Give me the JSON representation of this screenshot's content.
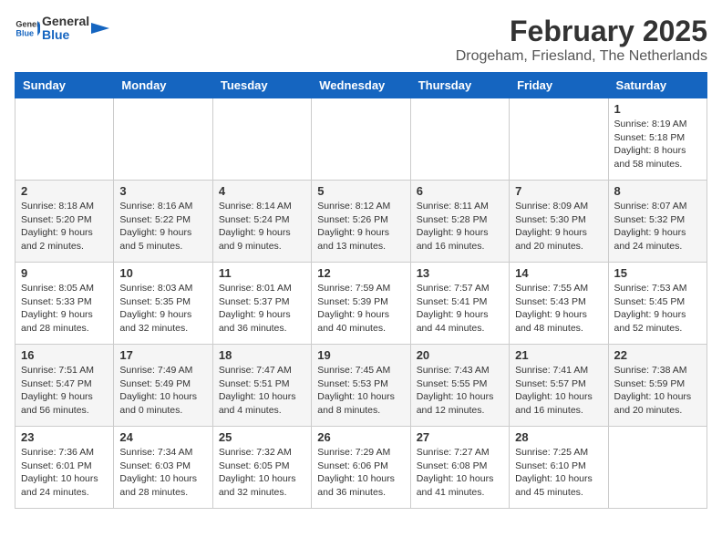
{
  "header": {
    "logo_general": "General",
    "logo_blue": "Blue",
    "month_year": "February 2025",
    "location": "Drogeham, Friesland, The Netherlands"
  },
  "weekdays": [
    "Sunday",
    "Monday",
    "Tuesday",
    "Wednesday",
    "Thursday",
    "Friday",
    "Saturday"
  ],
  "weeks": [
    [
      {
        "day": "",
        "info": ""
      },
      {
        "day": "",
        "info": ""
      },
      {
        "day": "",
        "info": ""
      },
      {
        "day": "",
        "info": ""
      },
      {
        "day": "",
        "info": ""
      },
      {
        "day": "",
        "info": ""
      },
      {
        "day": "1",
        "info": "Sunrise: 8:19 AM\nSunset: 5:18 PM\nDaylight: 8 hours and 58 minutes."
      }
    ],
    [
      {
        "day": "2",
        "info": "Sunrise: 8:18 AM\nSunset: 5:20 PM\nDaylight: 9 hours and 2 minutes."
      },
      {
        "day": "3",
        "info": "Sunrise: 8:16 AM\nSunset: 5:22 PM\nDaylight: 9 hours and 5 minutes."
      },
      {
        "day": "4",
        "info": "Sunrise: 8:14 AM\nSunset: 5:24 PM\nDaylight: 9 hours and 9 minutes."
      },
      {
        "day": "5",
        "info": "Sunrise: 8:12 AM\nSunset: 5:26 PM\nDaylight: 9 hours and 13 minutes."
      },
      {
        "day": "6",
        "info": "Sunrise: 8:11 AM\nSunset: 5:28 PM\nDaylight: 9 hours and 16 minutes."
      },
      {
        "day": "7",
        "info": "Sunrise: 8:09 AM\nSunset: 5:30 PM\nDaylight: 9 hours and 20 minutes."
      },
      {
        "day": "8",
        "info": "Sunrise: 8:07 AM\nSunset: 5:32 PM\nDaylight: 9 hours and 24 minutes."
      }
    ],
    [
      {
        "day": "9",
        "info": "Sunrise: 8:05 AM\nSunset: 5:33 PM\nDaylight: 9 hours and 28 minutes."
      },
      {
        "day": "10",
        "info": "Sunrise: 8:03 AM\nSunset: 5:35 PM\nDaylight: 9 hours and 32 minutes."
      },
      {
        "day": "11",
        "info": "Sunrise: 8:01 AM\nSunset: 5:37 PM\nDaylight: 9 hours and 36 minutes."
      },
      {
        "day": "12",
        "info": "Sunrise: 7:59 AM\nSunset: 5:39 PM\nDaylight: 9 hours and 40 minutes."
      },
      {
        "day": "13",
        "info": "Sunrise: 7:57 AM\nSunset: 5:41 PM\nDaylight: 9 hours and 44 minutes."
      },
      {
        "day": "14",
        "info": "Sunrise: 7:55 AM\nSunset: 5:43 PM\nDaylight: 9 hours and 48 minutes."
      },
      {
        "day": "15",
        "info": "Sunrise: 7:53 AM\nSunset: 5:45 PM\nDaylight: 9 hours and 52 minutes."
      }
    ],
    [
      {
        "day": "16",
        "info": "Sunrise: 7:51 AM\nSunset: 5:47 PM\nDaylight: 9 hours and 56 minutes."
      },
      {
        "day": "17",
        "info": "Sunrise: 7:49 AM\nSunset: 5:49 PM\nDaylight: 10 hours and 0 minutes."
      },
      {
        "day": "18",
        "info": "Sunrise: 7:47 AM\nSunset: 5:51 PM\nDaylight: 10 hours and 4 minutes."
      },
      {
        "day": "19",
        "info": "Sunrise: 7:45 AM\nSunset: 5:53 PM\nDaylight: 10 hours and 8 minutes."
      },
      {
        "day": "20",
        "info": "Sunrise: 7:43 AM\nSunset: 5:55 PM\nDaylight: 10 hours and 12 minutes."
      },
      {
        "day": "21",
        "info": "Sunrise: 7:41 AM\nSunset: 5:57 PM\nDaylight: 10 hours and 16 minutes."
      },
      {
        "day": "22",
        "info": "Sunrise: 7:38 AM\nSunset: 5:59 PM\nDaylight: 10 hours and 20 minutes."
      }
    ],
    [
      {
        "day": "23",
        "info": "Sunrise: 7:36 AM\nSunset: 6:01 PM\nDaylight: 10 hours and 24 minutes."
      },
      {
        "day": "24",
        "info": "Sunrise: 7:34 AM\nSunset: 6:03 PM\nDaylight: 10 hours and 28 minutes."
      },
      {
        "day": "25",
        "info": "Sunrise: 7:32 AM\nSunset: 6:05 PM\nDaylight: 10 hours and 32 minutes."
      },
      {
        "day": "26",
        "info": "Sunrise: 7:29 AM\nSunset: 6:06 PM\nDaylight: 10 hours and 36 minutes."
      },
      {
        "day": "27",
        "info": "Sunrise: 7:27 AM\nSunset: 6:08 PM\nDaylight: 10 hours and 41 minutes."
      },
      {
        "day": "28",
        "info": "Sunrise: 7:25 AM\nSunset: 6:10 PM\nDaylight: 10 hours and 45 minutes."
      },
      {
        "day": "",
        "info": ""
      }
    ]
  ]
}
